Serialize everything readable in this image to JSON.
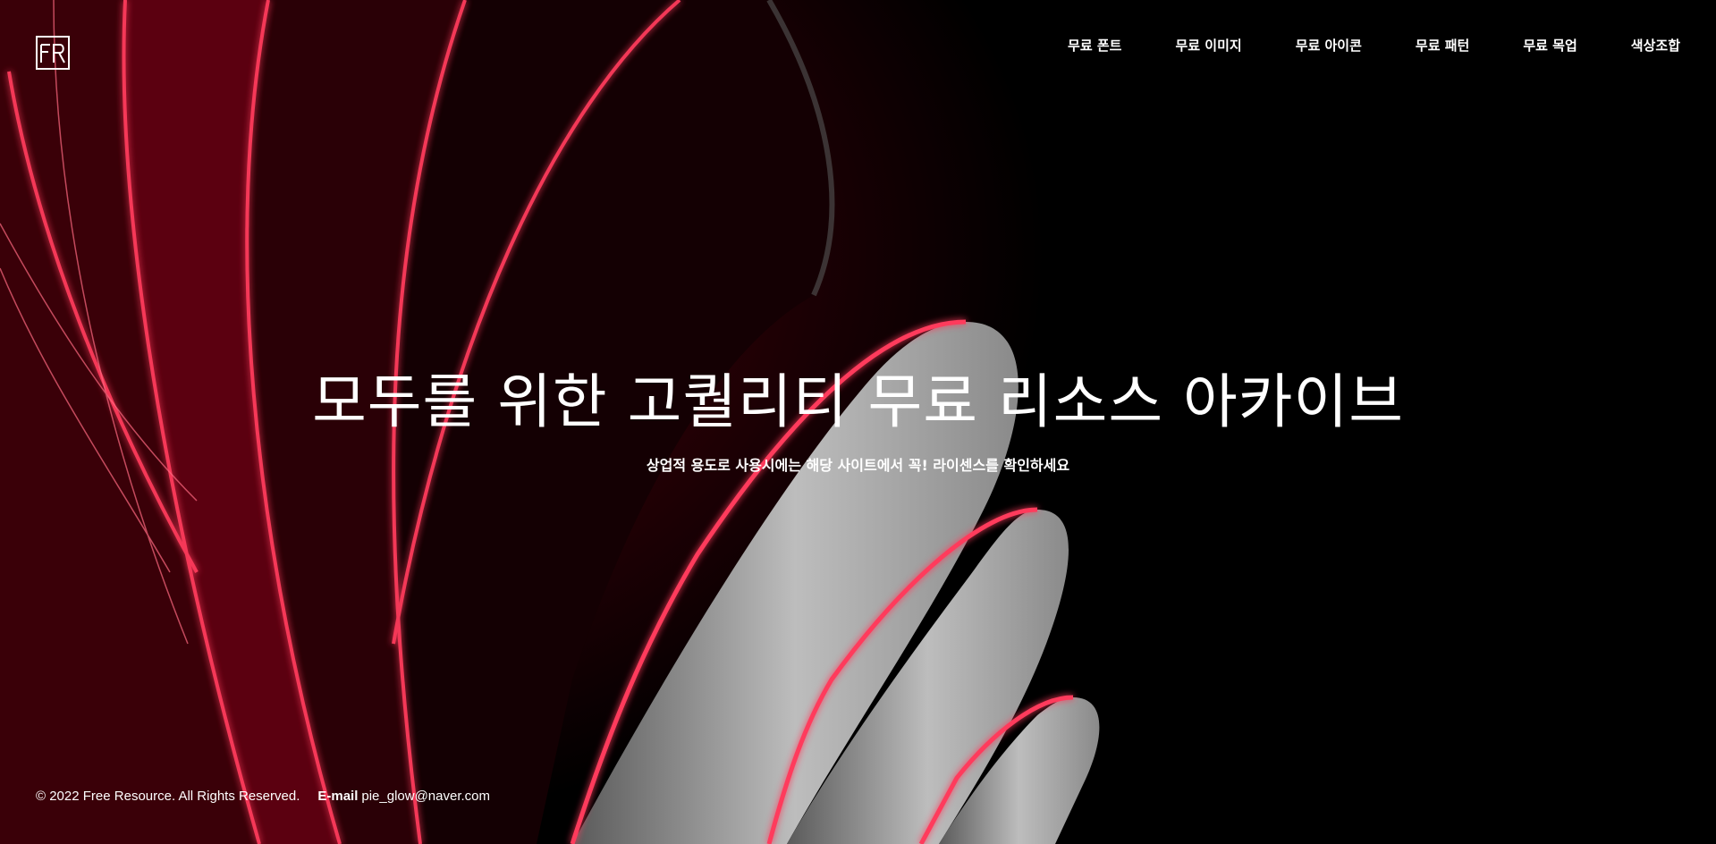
{
  "brand": {
    "logo_text": "FR",
    "logo_icon": "fr-logo-icon"
  },
  "nav": {
    "items": [
      {
        "label": "무료 폰트"
      },
      {
        "label": "무료 이미지"
      },
      {
        "label": "무료 아이콘"
      },
      {
        "label": "무료 패턴"
      },
      {
        "label": "무료 목업"
      },
      {
        "label": "색상조합"
      }
    ]
  },
  "hero": {
    "headline": "모두를 위한 고퀄리티 무료 리소스 아카이브",
    "subline": "상업적 용도로 사용시에는 해당 사이트에서 꼭! 라이센스를 확인하세요"
  },
  "footer": {
    "copyright": "© 2022 Free Resource. All Rights Reserved.",
    "email_label": "E-mail",
    "email": "pie_glow@naver.com"
  },
  "colors": {
    "background": "#000000",
    "neon_red": "#ff3b5c",
    "deep_red": "#8a0010",
    "text": "#ffffff"
  }
}
